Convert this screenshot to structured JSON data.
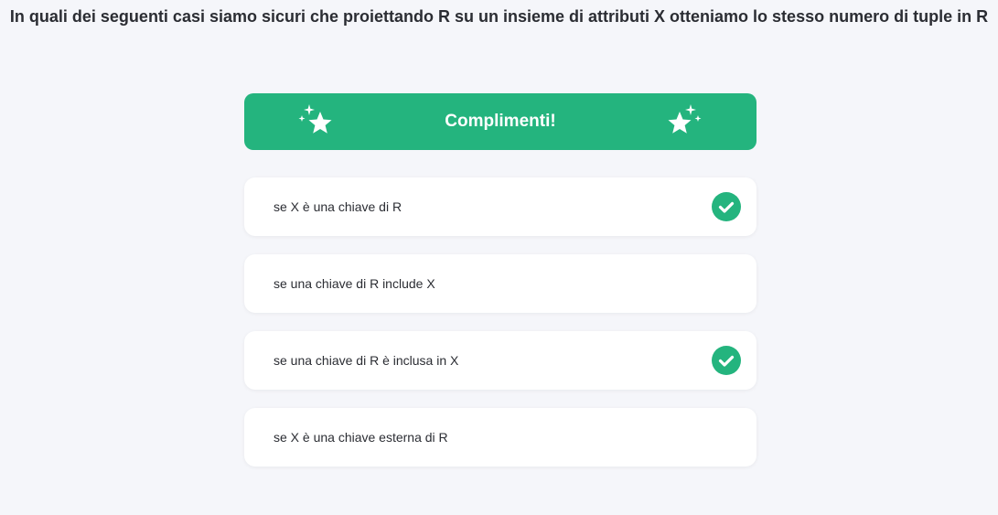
{
  "question": "In quali dei seguenti casi siamo sicuri che proiettando R su un insieme di attributi X otteniamo lo stesso numero di tuple in R",
  "banner": {
    "text": "Complimenti!",
    "color": "#24b47e"
  },
  "options": [
    {
      "label": "se X è una chiave di R",
      "correct": true
    },
    {
      "label": "se una chiave di R include X",
      "correct": false
    },
    {
      "label": "se una chiave di R è inclusa in X",
      "correct": true
    },
    {
      "label": "se X è una chiave esterna di R",
      "correct": false
    }
  ],
  "icons": {
    "banner_left": "sparkle-star-icon",
    "banner_right": "sparkle-star-icon",
    "correct_mark": "check-circle-icon"
  }
}
